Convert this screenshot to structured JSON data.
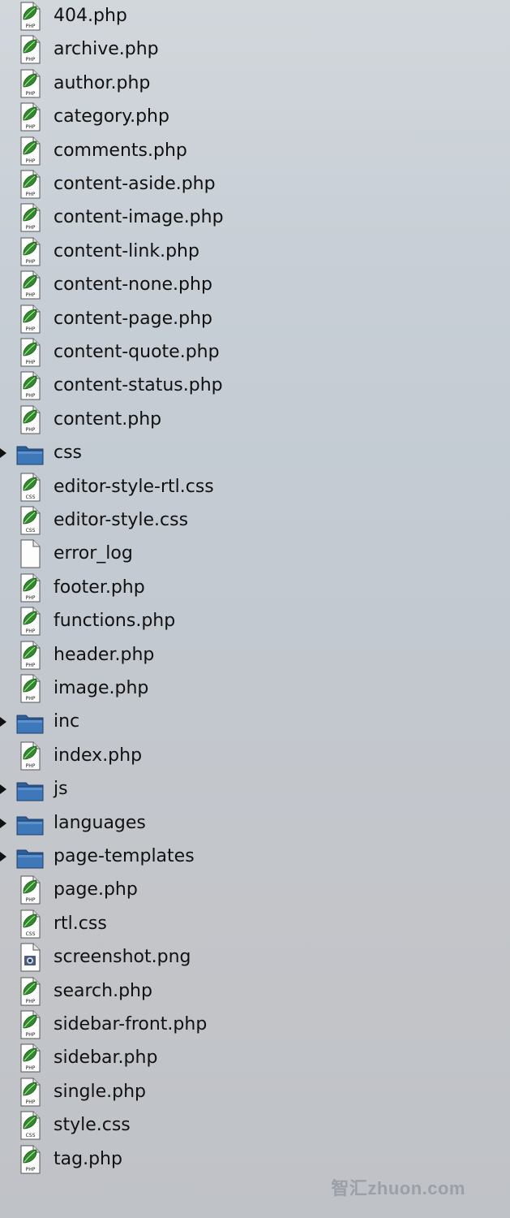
{
  "files": [
    {
      "name": "404.php",
      "type": "php"
    },
    {
      "name": "archive.php",
      "type": "php"
    },
    {
      "name": "author.php",
      "type": "php"
    },
    {
      "name": "category.php",
      "type": "php"
    },
    {
      "name": "comments.php",
      "type": "php"
    },
    {
      "name": "content-aside.php",
      "type": "php"
    },
    {
      "name": "content-image.php",
      "type": "php"
    },
    {
      "name": "content-link.php",
      "type": "php"
    },
    {
      "name": "content-none.php",
      "type": "php"
    },
    {
      "name": "content-page.php",
      "type": "php"
    },
    {
      "name": "content-quote.php",
      "type": "php"
    },
    {
      "name": "content-status.php",
      "type": "php"
    },
    {
      "name": "content.php",
      "type": "php"
    },
    {
      "name": "css",
      "type": "folder"
    },
    {
      "name": "editor-style-rtl.css",
      "type": "css"
    },
    {
      "name": "editor-style.css",
      "type": "css"
    },
    {
      "name": "error_log",
      "type": "blank"
    },
    {
      "name": "footer.php",
      "type": "php"
    },
    {
      "name": "functions.php",
      "type": "php"
    },
    {
      "name": "header.php",
      "type": "php"
    },
    {
      "name": "image.php",
      "type": "php"
    },
    {
      "name": "inc",
      "type": "folder"
    },
    {
      "name": "index.php",
      "type": "php"
    },
    {
      "name": "js",
      "type": "folder"
    },
    {
      "name": "languages",
      "type": "folder"
    },
    {
      "name": "page-templates",
      "type": "folder"
    },
    {
      "name": "page.php",
      "type": "php"
    },
    {
      "name": "rtl.css",
      "type": "css"
    },
    {
      "name": "screenshot.png",
      "type": "image"
    },
    {
      "name": "search.php",
      "type": "php"
    },
    {
      "name": "sidebar-front.php",
      "type": "php"
    },
    {
      "name": "sidebar.php",
      "type": "php"
    },
    {
      "name": "single.php",
      "type": "php"
    },
    {
      "name": "style.css",
      "type": "css"
    },
    {
      "name": "tag.php",
      "type": "php"
    }
  ],
  "icon_badges": {
    "php": "PHP",
    "css": "CSS"
  },
  "watermark": "智汇zhuon.com",
  "colors": {
    "leaf": "#2f8a2a",
    "folder": "#3f78b8",
    "text": "#111111"
  }
}
